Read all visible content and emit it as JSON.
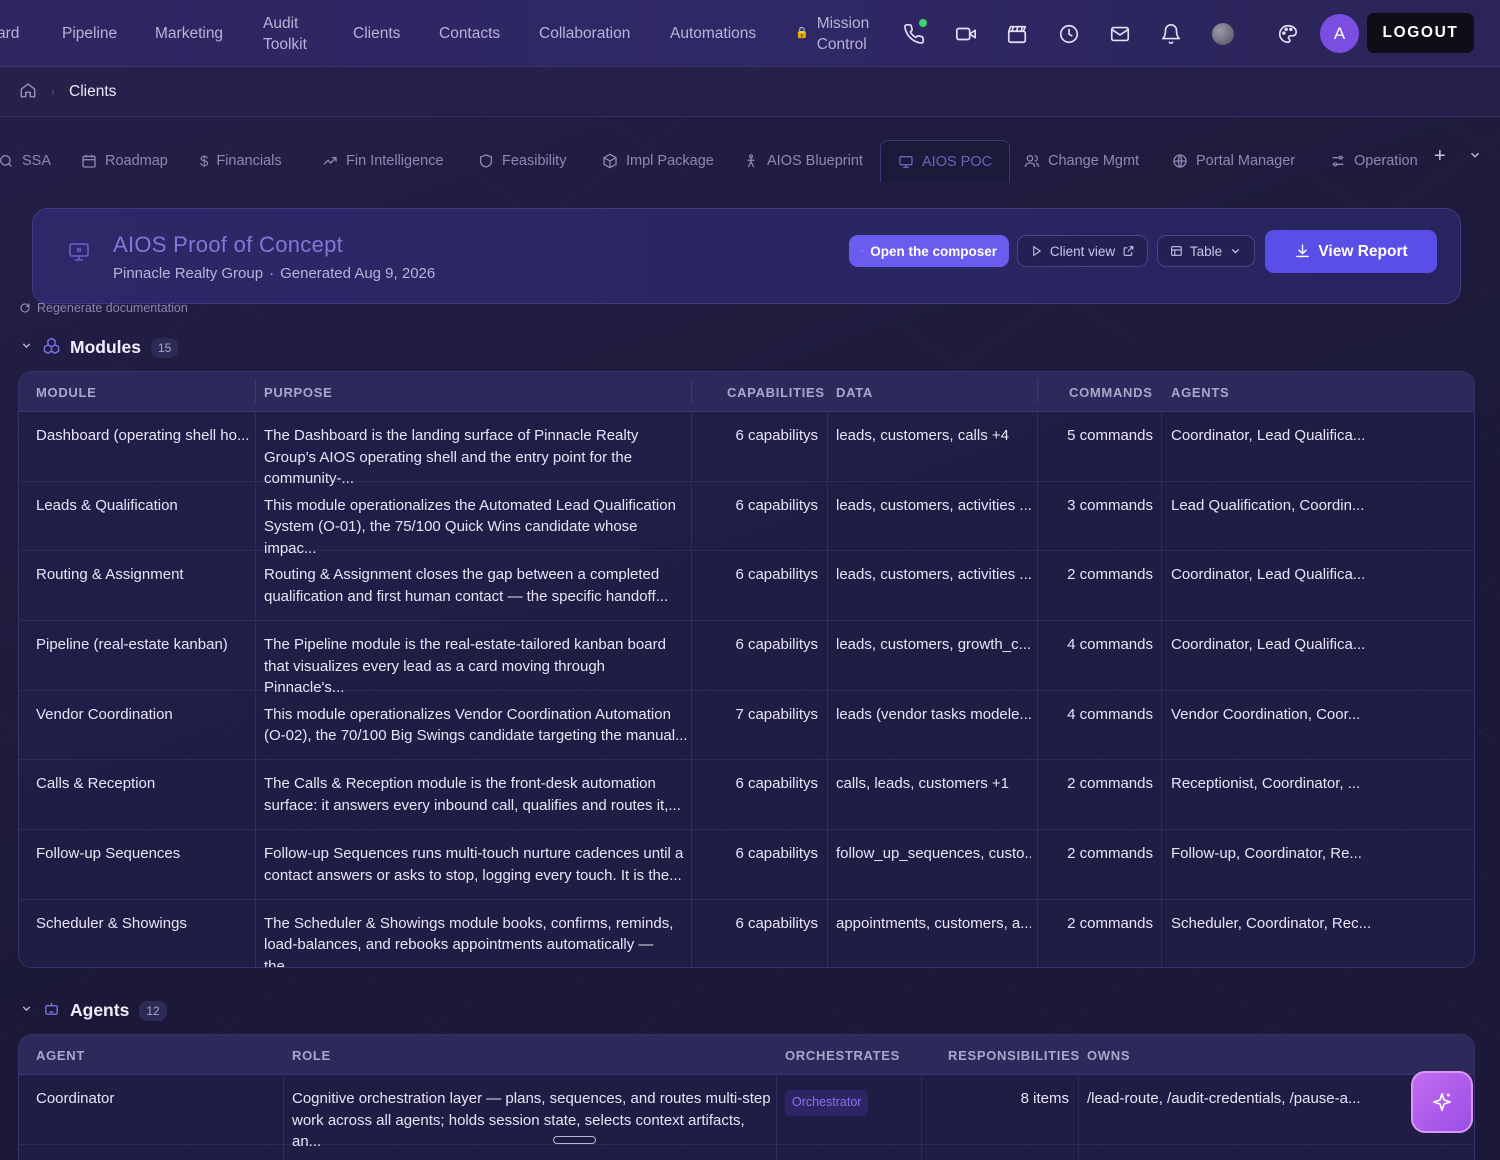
{
  "nav": {
    "items": [
      "ard",
      "Pipeline",
      "Marketing",
      "Audit Toolkit",
      "Clients",
      "Contacts",
      "Collaboration",
      "Automations",
      "Mission Control"
    ],
    "icons": [
      "phone-icon",
      "video-icon",
      "clapperboard-icon",
      "clock-icon",
      "mail-icon",
      "bell-icon",
      "orb-icon",
      "palette-icon"
    ],
    "avatar_initial": "A",
    "logout_label": "LOGOUT",
    "phone_status_color": "#3fd56e"
  },
  "breadcrumb": {
    "current": "Clients"
  },
  "tabs": [
    {
      "label": "SSA",
      "icon": "search-icon"
    },
    {
      "label": "Roadmap",
      "icon": "calendar-icon"
    },
    {
      "label": "Financials",
      "icon": "dollar-icon"
    },
    {
      "label": "Fin Intelligence",
      "icon": "trend-icon"
    },
    {
      "label": "Feasibility",
      "icon": "shield-icon"
    },
    {
      "label": "Impl Package",
      "icon": "package-icon"
    },
    {
      "label": "AIOS Blueprint",
      "icon": "person-icon"
    },
    {
      "label": "AIOS POC",
      "icon": "monitor-icon",
      "active": true
    },
    {
      "label": "Change Mgmt",
      "icon": "users-icon"
    },
    {
      "label": "Portal Manager",
      "icon": "globe-icon"
    },
    {
      "label": "Operation",
      "icon": "sliders-icon"
    }
  ],
  "header": {
    "title": "AIOS Proof of Concept",
    "client": "Pinnacle Realty Group",
    "separator": "·",
    "generated": "Generated Aug 9, 2026",
    "composer_label": "Open the composer",
    "client_view_label": "Client view",
    "table_label": "Table",
    "view_report_label": "View Report",
    "regen_label": "Regenerate documentation"
  },
  "modules": {
    "title": "Modules",
    "count": "15",
    "columns": [
      "MODULE",
      "PURPOSE",
      "CAPABILITIES",
      "DATA",
      "COMMANDS",
      "AGENTS"
    ],
    "rows": [
      [
        "Dashboard (operating shell ho...",
        "The Dashboard is the landing surface of Pinnacle Realty Group's AIOS operating shell and the entry point for the community-...",
        "6 capabilitys",
        "leads, customers, calls +4",
        "5 commands",
        "Coordinator, Lead Qualifica..."
      ],
      [
        "Leads & Qualification",
        "This module operationalizes the Automated Lead Qualification System (O-01), the 75/100 Quick Wins candidate whose impac...",
        "6 capabilitys",
        "leads, customers, activities ...",
        "3 commands",
        "Lead Qualification, Coordin..."
      ],
      [
        "Routing & Assignment",
        "Routing & Assignment closes the gap between a completed qualification and first human contact — the specific handoff...",
        "6 capabilitys",
        "leads, customers, activities ...",
        "2 commands",
        "Coordinator, Lead Qualifica..."
      ],
      [
        "Pipeline (real-estate kanban)",
        "The Pipeline module is the real-estate-tailored kanban board that visualizes every lead as a card moving through Pinnacle's...",
        "6 capabilitys",
        "leads, customers, growth_c...",
        "4 commands",
        "Coordinator, Lead Qualifica..."
      ],
      [
        "Vendor Coordination",
        "This module operationalizes Vendor Coordination Automation (O-02), the 70/100 Big Swings candidate targeting the manual...",
        "7 capabilitys",
        "leads (vendor tasks modele...",
        "4 commands",
        "Vendor Coordination, Coor..."
      ],
      [
        "Calls & Reception",
        "The Calls & Reception module is the front-desk automation surface: it answers every inbound call, qualifies and routes it,...",
        "6 capabilitys",
        "calls, leads, customers +1",
        "2 commands",
        "Receptionist, Coordinator, ..."
      ],
      [
        "Follow-up Sequences",
        "Follow-up Sequences runs multi-touch nurture cadences until a contact answers or asks to stop, logging every touch. It is the...",
        "6 capabilitys",
        "follow_up_sequences, custo...",
        "2 commands",
        "Follow-up, Coordinator, Re..."
      ],
      [
        "Scheduler & Showings",
        "The Scheduler & Showings module books, confirms, reminds, load-balances, and rebooks appointments automatically — the...",
        "6 capabilitys",
        "appointments, customers, a...",
        "2 commands",
        "Scheduler, Coordinator, Rec..."
      ]
    ]
  },
  "agents": {
    "title": "Agents",
    "count": "12",
    "columns": [
      "AGENT",
      "ROLE",
      "ORCHESTRATES",
      "RESPONSIBILITIES",
      "OWNS"
    ],
    "rows": [
      [
        "Coordinator",
        "Cognitive orchestration layer — plans, sequences, and routes multi-step work across all agents; holds session state, selects context artifacts, an...",
        "Orchestrator",
        "8 items",
        "/lead-route, /audit-credentials, /pause-a..."
      ]
    ]
  }
}
